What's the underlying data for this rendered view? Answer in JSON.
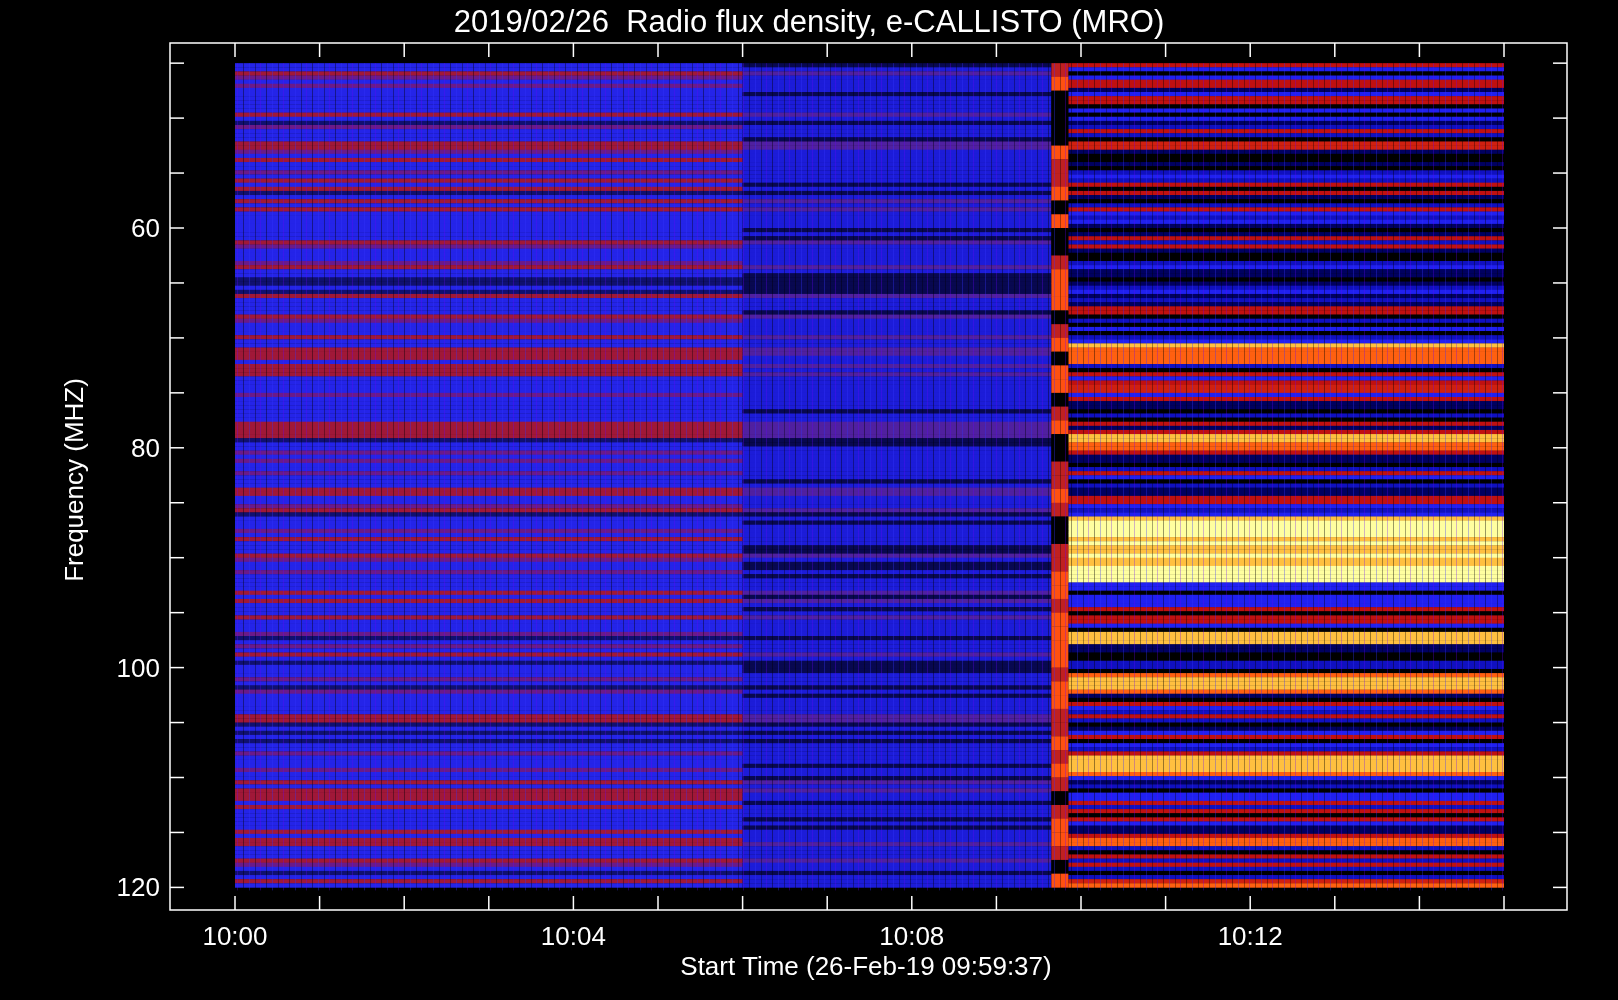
{
  "title": "2019/02/26  Radio flux density, e-CALLISTO (MRO)",
  "plot": {
    "xlabel": "Start Time (26-Feb-19 09:59:37)",
    "ylabel": "Frequency (MHZ)",
    "xticks": [
      "10:00",
      "10:04",
      "10:08",
      "10:12"
    ],
    "yticks": [
      "60",
      "80",
      "100",
      "120"
    ]
  }
}
